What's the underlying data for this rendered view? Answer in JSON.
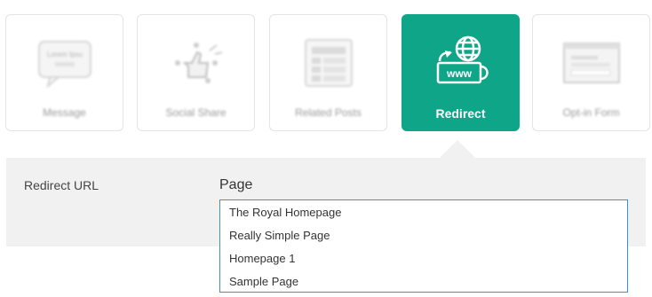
{
  "types": [
    {
      "label": "Message",
      "icon": "message-icon",
      "glyph_text": "Lorem Ipsu",
      "active": false
    },
    {
      "label": "Social Share",
      "icon": "social-share-icon",
      "active": false
    },
    {
      "label": "Related Posts",
      "icon": "related-posts-icon",
      "active": false
    },
    {
      "label": "Redirect",
      "icon": "redirect-icon",
      "glyph_text": "www",
      "active": true
    },
    {
      "label": "Opt-in Form",
      "icon": "opt-in-form-icon",
      "active": false
    }
  ],
  "settings": {
    "field_label": "Redirect URL",
    "select_label": "Page",
    "options": [
      "The Royal Homepage",
      "Really Simple Page",
      "Homepage 1",
      "Sample Page"
    ]
  },
  "colors": {
    "accent": "#0ea589",
    "panel": "#f1f1f1",
    "focus_border": "#3d8fd1"
  }
}
